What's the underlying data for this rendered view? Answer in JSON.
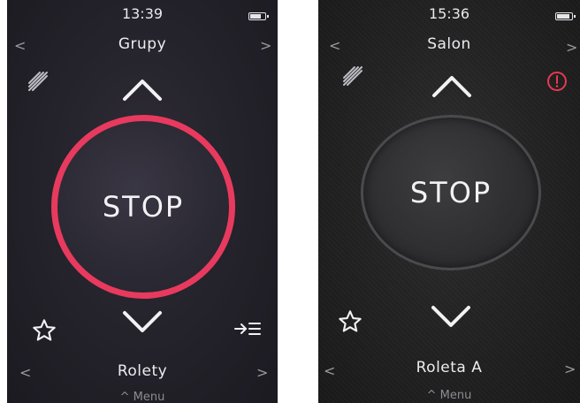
{
  "colors": {
    "active_ring": "#e83a5e",
    "inactive_ring": "#4a4a4e",
    "warning": "#e8384f",
    "text": "#ececf0"
  },
  "screens": [
    {
      "time": "13:39",
      "top_nav": {
        "label": "Grupy",
        "prev": "<",
        "next": ">"
      },
      "stop_label": "STOP",
      "stop_state": "active",
      "bottom_nav": {
        "label": "Rolety",
        "prev": "<",
        "next": ">"
      },
      "menu_hint": "^ Menu",
      "icons": [
        "stripes-icon",
        "chevron-up-icon",
        "chevron-down-icon",
        "star-icon",
        "arrow-list-icon"
      ]
    },
    {
      "time": "15:36",
      "top_nav": {
        "label": "Salon",
        "prev": "<",
        "next": ">"
      },
      "stop_label": "STOP",
      "stop_state": "inactive",
      "bottom_nav": {
        "label": "Roleta A",
        "prev": "<",
        "next": ">"
      },
      "menu_hint": "^ Menu",
      "icons": [
        "stripes-icon",
        "warning-icon",
        "chevron-up-icon",
        "chevron-down-icon",
        "star-icon"
      ]
    }
  ]
}
